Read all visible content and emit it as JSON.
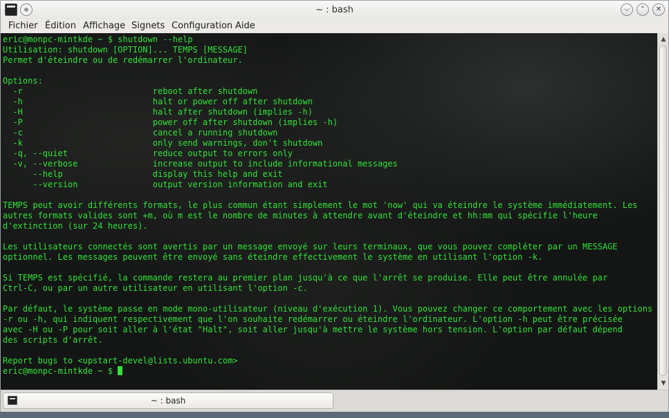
{
  "window": {
    "title": "~ : bash"
  },
  "menu": {
    "items": [
      "Fichier",
      "Édition",
      "Affichage",
      "Signets",
      "Configuration",
      "Aide"
    ]
  },
  "terminal": {
    "lines": [
      "eric@monpc-mintkde ~ $ shutdown --help",
      "Utilisation: shutdown [OPTION]... TEMPS [MESSAGE]",
      "Permet d'éteindre ou de redémarrer l'ordinateur.",
      "",
      "Options:",
      "  -r                          reboot after shutdown",
      "  -h                          halt or power off after shutdown",
      "  -H                          halt after shutdown (implies -h)",
      "  -P                          power off after shutdown (implies -h)",
      "  -c                          cancel a running shutdown",
      "  -k                          only send warnings, don't shutdown",
      "  -q, --quiet                 reduce output to errors only",
      "  -v, --verbose               increase output to include informational messages",
      "      --help                  display this help and exit",
      "      --version               output version information and exit",
      "",
      "TEMPS peut avoir différents formats, le plus commun étant simplement le mot 'now' qui va éteindre le système immédiatement. Les",
      "autres formats valides sont +m, où m est le nombre de minutes à attendre avant d'éteindre et hh:mm qui spécifie l'heure",
      "d'extinction (sur 24 heures).",
      "",
      "Les utilisateurs connectés sont avertis par un message envoyé sur leurs terminaux, que vous pouvez compléter par un MESSAGE",
      "optionnel. Les messages peuvent être envoyé sans éteindre effectivement le système en utilisant l'option -k.",
      "",
      "Si TEMPS est spécifié, la commande restera au premier plan jusqu'à ce que l'arrêt se produise. Elle peut être annulée par",
      "Ctrl-C, ou par un autre utilisateur en utilisant l'option -c.",
      "",
      "Par défaut, le système passe en mode mono-utilisateur (niveau d'exécution 1). Vous pouvez changer ce comportement avec les options",
      "-r ou -h, qui indiquent respectivement que l'on souhaite redémarrer ou éteindre l'ordinateur. L'option -h peut être précisée",
      "avec -H ou -P pour soit aller à l'état \"Halt\", soit aller jusqu'à mettre le système hors tension. L'option par défaut dépend",
      "des scripts d'arrêt.",
      "",
      "Report bugs to <upstart-devel@lists.ubuntu.com>"
    ],
    "prompt": "eric@monpc-mintkde ~ $ ",
    "text_color": "#33e13a",
    "background_color": "#141615"
  },
  "tabs": [
    {
      "label": "~ : bash",
      "active": true
    }
  ],
  "icons": {
    "app": "terminal-icon",
    "pin": "keep-above-icon",
    "minimize": "chevron-down-icon",
    "maximize": "chevron-up-icon",
    "close": "close-icon",
    "scroll_up": "arrow-up-icon",
    "scroll_down": "arrow-down-icon"
  }
}
